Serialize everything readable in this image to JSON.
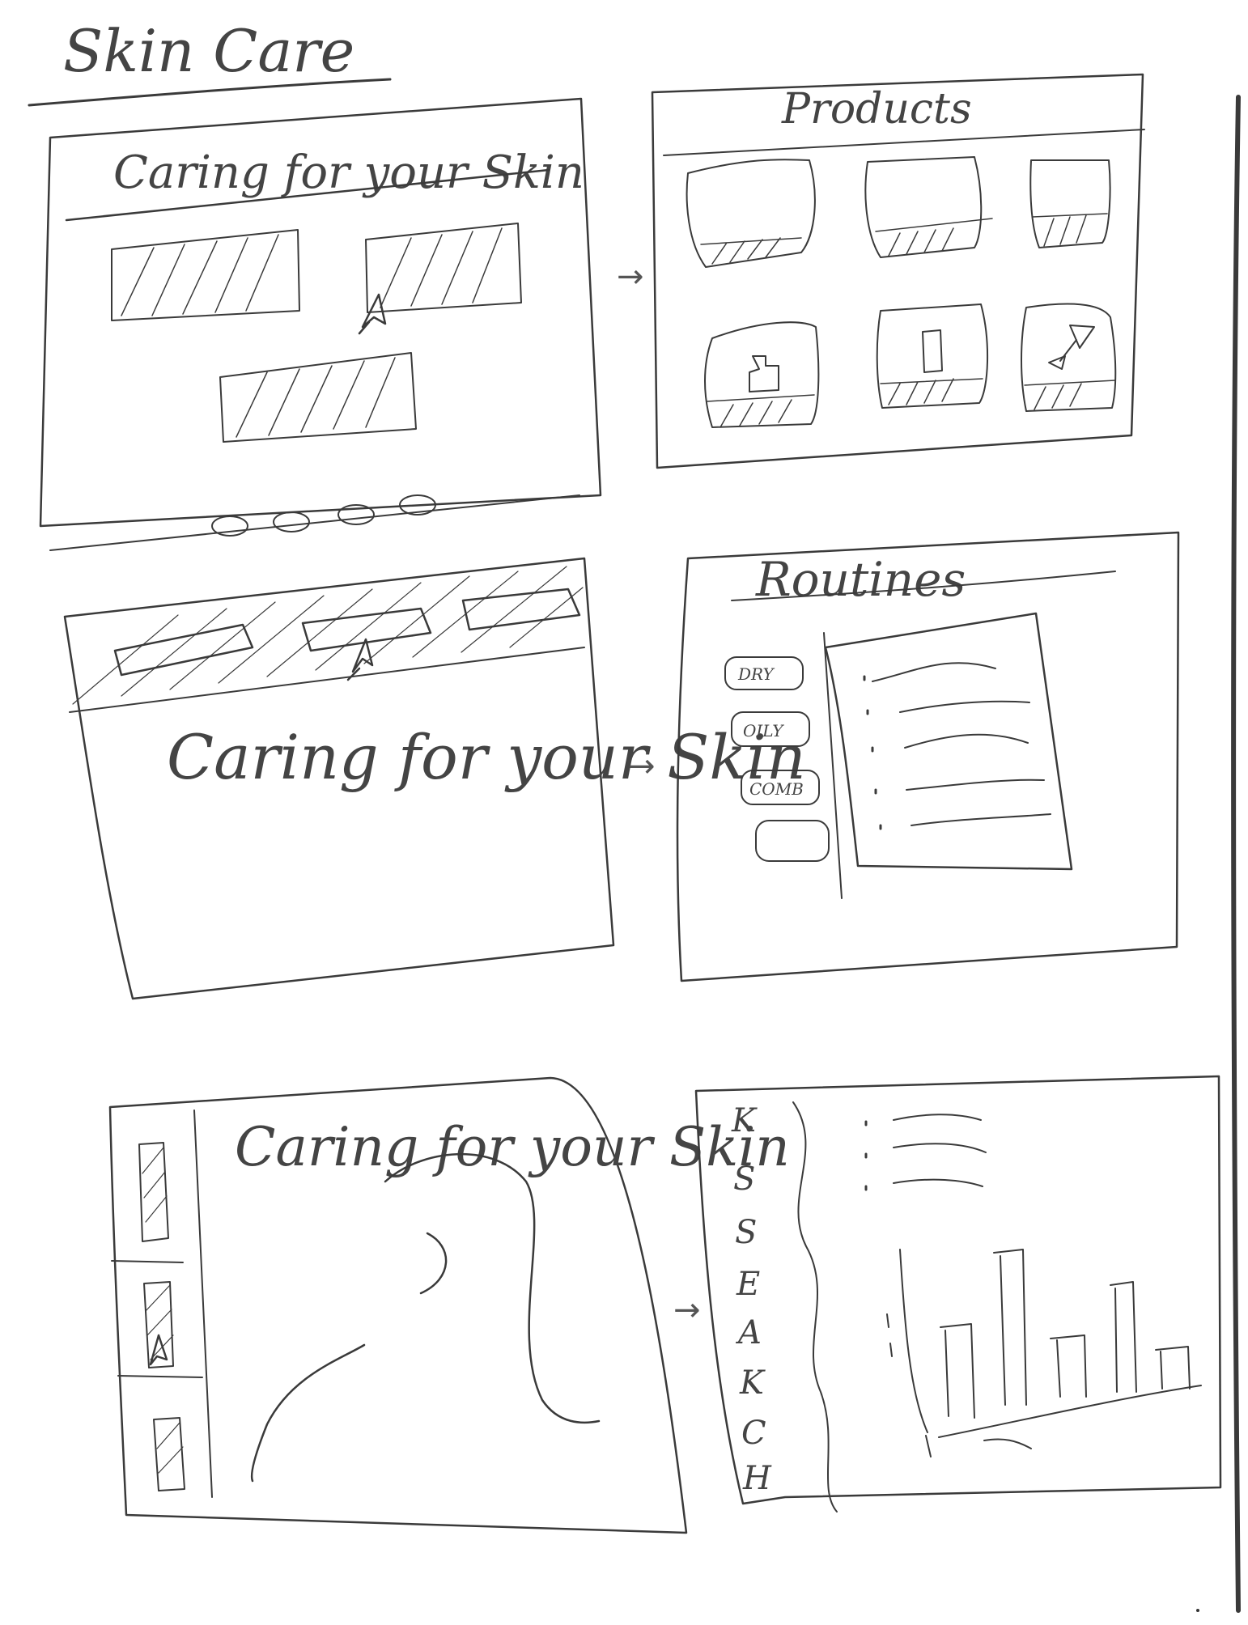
{
  "sheet": {
    "title": "Skin Care"
  },
  "frames": [
    {
      "id": 1,
      "heading": "Caring for your Skin",
      "carousel_dots": 4
    },
    {
      "id": 2,
      "heading": "Products"
    },
    {
      "id": 3,
      "heading": "Caring for your Skin"
    },
    {
      "id": 4,
      "heading": "Routines",
      "tabs": [
        "DRY",
        "OILY",
        "COMB",
        ""
      ]
    },
    {
      "id": 5,
      "heading": "Caring for your Skin"
    },
    {
      "id": 6,
      "sidebar_letters": [
        "K",
        "S",
        "S",
        "E",
        "A",
        "K",
        "C",
        "H"
      ]
    }
  ],
  "arrow_glyph": "→"
}
